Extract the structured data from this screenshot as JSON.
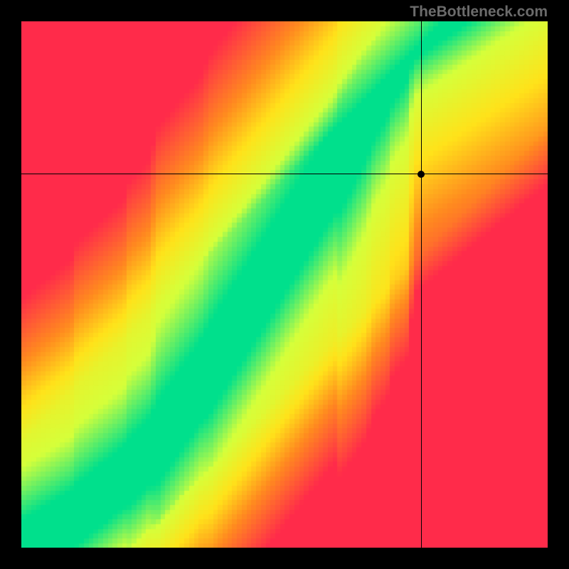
{
  "watermark": "TheBottleneck.com",
  "chart_data": {
    "type": "heatmap",
    "title": "",
    "xlabel": "",
    "ylabel": "",
    "xlim": [
      0,
      100
    ],
    "ylim": [
      0,
      100
    ],
    "grid": false,
    "legend": false,
    "color_scale": {
      "description": "Compatibility / bottleneck score. Green band is the ideal balance curve; red is severe bottleneck; yellow/orange is moderate.",
      "stops": [
        {
          "value": 0,
          "color": "#ff2b4a"
        },
        {
          "value": 35,
          "color": "#ff8a1f"
        },
        {
          "value": 60,
          "color": "#ffe21a"
        },
        {
          "value": 85,
          "color": "#d5ff3a"
        },
        {
          "value": 100,
          "color": "#00e08c"
        }
      ]
    },
    "ideal_curve": {
      "description": "Approximate centerline of the green band (y as a function of x, both 0-100).",
      "x": [
        0,
        5,
        10,
        15,
        20,
        25,
        30,
        35,
        40,
        45,
        50,
        55,
        60,
        63,
        66,
        70,
        74,
        77
      ],
      "y": [
        0,
        3,
        6,
        10,
        14,
        19,
        26,
        33,
        41,
        49,
        57,
        65,
        73,
        79,
        85,
        92,
        98,
        100
      ]
    },
    "marker": {
      "description": "User's selected configuration point shown by the crosshair.",
      "x": 76,
      "y": 71
    },
    "annotations": []
  }
}
